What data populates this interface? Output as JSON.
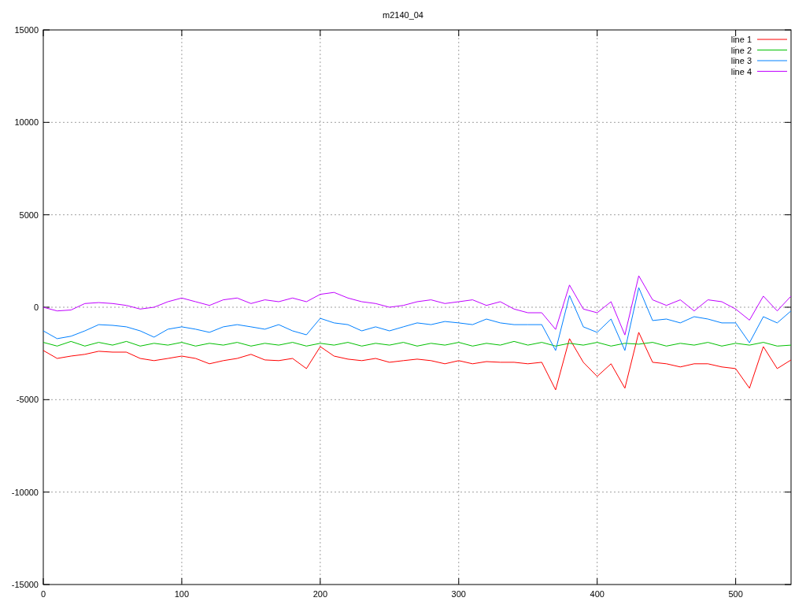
{
  "chart_data": {
    "type": "line",
    "title": "m2140_04",
    "x": [
      0,
      10,
      20,
      30,
      40,
      50,
      60,
      70,
      80,
      90,
      100,
      110,
      120,
      130,
      140,
      150,
      160,
      170,
      180,
      190,
      200,
      210,
      220,
      230,
      240,
      250,
      260,
      270,
      280,
      290,
      300,
      310,
      320,
      330,
      340,
      350,
      360,
      370,
      380,
      390,
      400,
      410,
      420,
      430,
      440,
      450,
      460,
      470,
      480,
      490,
      500,
      510,
      520,
      530,
      540
    ],
    "series": [
      {
        "name": "line 1",
        "color": "#ff0000",
        "values": [
          -2340,
          -2770,
          -2640,
          -2550,
          -2380,
          -2430,
          -2430,
          -2770,
          -2890,
          -2770,
          -2640,
          -2770,
          -3060,
          -2890,
          -2770,
          -2550,
          -2850,
          -2890,
          -2770,
          -3320,
          -2130,
          -2640,
          -2810,
          -2890,
          -2770,
          -2980,
          -2890,
          -2810,
          -2890,
          -3060,
          -2890,
          -3060,
          -2940,
          -2980,
          -2980,
          -3060,
          -2980,
          -4470,
          -1700,
          -2980,
          -3740,
          -3060,
          -4380,
          -1360,
          -2980,
          -3060,
          -3230,
          -3060,
          -3060,
          -3230,
          -3320,
          -4380,
          -2130,
          -3320,
          -2850
        ]
      },
      {
        "name": "line 2",
        "color": "#00c000",
        "values": [
          -1900,
          -2100,
          -1850,
          -2100,
          -1900,
          -2050,
          -1850,
          -2100,
          -1950,
          -2050,
          -1900,
          -2100,
          -1950,
          -2050,
          -1900,
          -2100,
          -1950,
          -2050,
          -1900,
          -2100,
          -1950,
          -2050,
          -1900,
          -2100,
          -1950,
          -2050,
          -1900,
          -2100,
          -1950,
          -2050,
          -1900,
          -2100,
          -1950,
          -2050,
          -1850,
          -2050,
          -1900,
          -2100,
          -1950,
          -2050,
          -1900,
          -2100,
          -1950,
          -2000,
          -1900,
          -2100,
          -1950,
          -2050,
          -1900,
          -2100,
          -1950,
          -2050,
          -1900,
          -2100,
          -2050
        ]
      },
      {
        "name": "line 3",
        "color": "#0080ff",
        "values": [
          -1280,
          -1700,
          -1570,
          -1280,
          -940,
          -980,
          -1060,
          -1280,
          -1620,
          -1190,
          -1060,
          -1190,
          -1360,
          -1060,
          -940,
          -1060,
          -1190,
          -940,
          -1280,
          -1490,
          -600,
          -850,
          -940,
          -1280,
          -1060,
          -1280,
          -1060,
          -850,
          -940,
          -770,
          -850,
          -940,
          -640,
          -850,
          -940,
          -940,
          -940,
          -2340,
          640,
          -1060,
          -1360,
          -640,
          -2340,
          1060,
          -720,
          -640,
          -850,
          -510,
          -640,
          -850,
          -850,
          -1920,
          -510,
          -850,
          -200
        ]
      },
      {
        "name": "line 4",
        "color": "#c000ff",
        "values": [
          0,
          -200,
          -150,
          200,
          250,
          200,
          100,
          -100,
          0,
          300,
          500,
          300,
          100,
          400,
          500,
          200,
          400,
          300,
          500,
          300,
          700,
          800,
          500,
          300,
          200,
          0,
          100,
          300,
          400,
          200,
          300,
          400,
          100,
          300,
          -100,
          -300,
          -300,
          -1200,
          1200,
          -100,
          -300,
          300,
          -1500,
          1700,
          400,
          100,
          400,
          -200,
          400,
          300,
          -100,
          -700,
          600,
          -200,
          600
        ]
      }
    ],
    "xlim": [
      0,
      540
    ],
    "ylim": [
      -15000,
      15000
    ],
    "xticks": [
      0,
      100,
      200,
      300,
      400,
      500
    ],
    "yticks": [
      -15000,
      -10000,
      -5000,
      0,
      5000,
      10000,
      15000
    ],
    "grid": true,
    "legend": true
  }
}
